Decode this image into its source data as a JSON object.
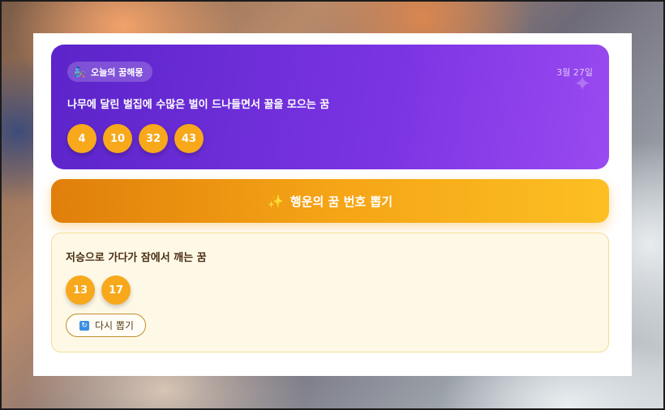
{
  "hero": {
    "tag_label": "오늘의 꿈해몽",
    "tag_icon": "genie-icon",
    "date": "3월 27일",
    "dream": "나무에 달린 벌집에 수많은 벌이 드나들면서 꿀을 모으는 꿈",
    "numbers": [
      "4",
      "10",
      "32",
      "43"
    ]
  },
  "draw_button": {
    "label": "행운의 꿈 번호 뽑기",
    "icon": "sparkles-icon"
  },
  "result": {
    "dream": "저승으로 가다가 잠에서 깨는 꿈",
    "numbers": [
      "13",
      "17"
    ],
    "retry_label": "다시 뽑기",
    "retry_icon": "refresh-icon"
  },
  "colors": {
    "hero_start": "#5b24c9",
    "hero_end": "#9a4af0",
    "ball": "#f7a81b",
    "button_start": "#e07f0b",
    "button_end": "#fcbf23",
    "result_bg": "#fef9e7",
    "result_border": "#f4dd93"
  }
}
